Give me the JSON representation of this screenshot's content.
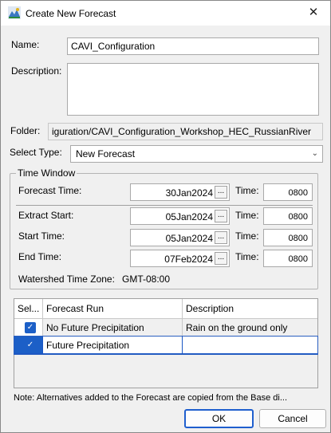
{
  "window": {
    "title": "Create New Forecast",
    "close_glyph": "✕",
    "app_icon": "hec-forecast-icon"
  },
  "form": {
    "name_label": "Name:",
    "name_value": "CAVI_Configuration",
    "description_label": "Description:",
    "description_value": "",
    "folder_label": "Folder:",
    "folder_value": "iguration/CAVI_Configuration_Workshop_HEC_RussianRiver",
    "select_type_label": "Select Type:",
    "select_type_value": "New Forecast"
  },
  "time_window": {
    "title": "Time Window",
    "time_label": "Time:",
    "browse_glyph": "...",
    "rows": [
      {
        "label": "Forecast Time:",
        "date": "30Jan2024",
        "time": "0800"
      },
      {
        "label": "Extract Start:",
        "date": "05Jan2024",
        "time": "0800"
      },
      {
        "label": "Start Time:",
        "date": "05Jan2024",
        "time": "0800"
      },
      {
        "label": "End Time:",
        "date": "07Feb2024",
        "time": "0800"
      }
    ],
    "timezone_label": "Watershed Time Zone:",
    "timezone_value": "GMT-08:00"
  },
  "runs_table": {
    "headers": [
      "Sel...",
      "Forecast Run",
      "Description"
    ],
    "rows": [
      {
        "checked": true,
        "run": "No Future Precipitation",
        "description": "Rain on the ground only"
      },
      {
        "checked": true,
        "run": "Future Precipitation",
        "description": ""
      }
    ]
  },
  "note": "Note: Alternatives added to the Forecast are copied from the Base di...",
  "buttons": {
    "ok": "OK",
    "cancel": "Cancel"
  },
  "colors": {
    "accent": "#1c5fc7",
    "background": "#f0f0f0"
  }
}
